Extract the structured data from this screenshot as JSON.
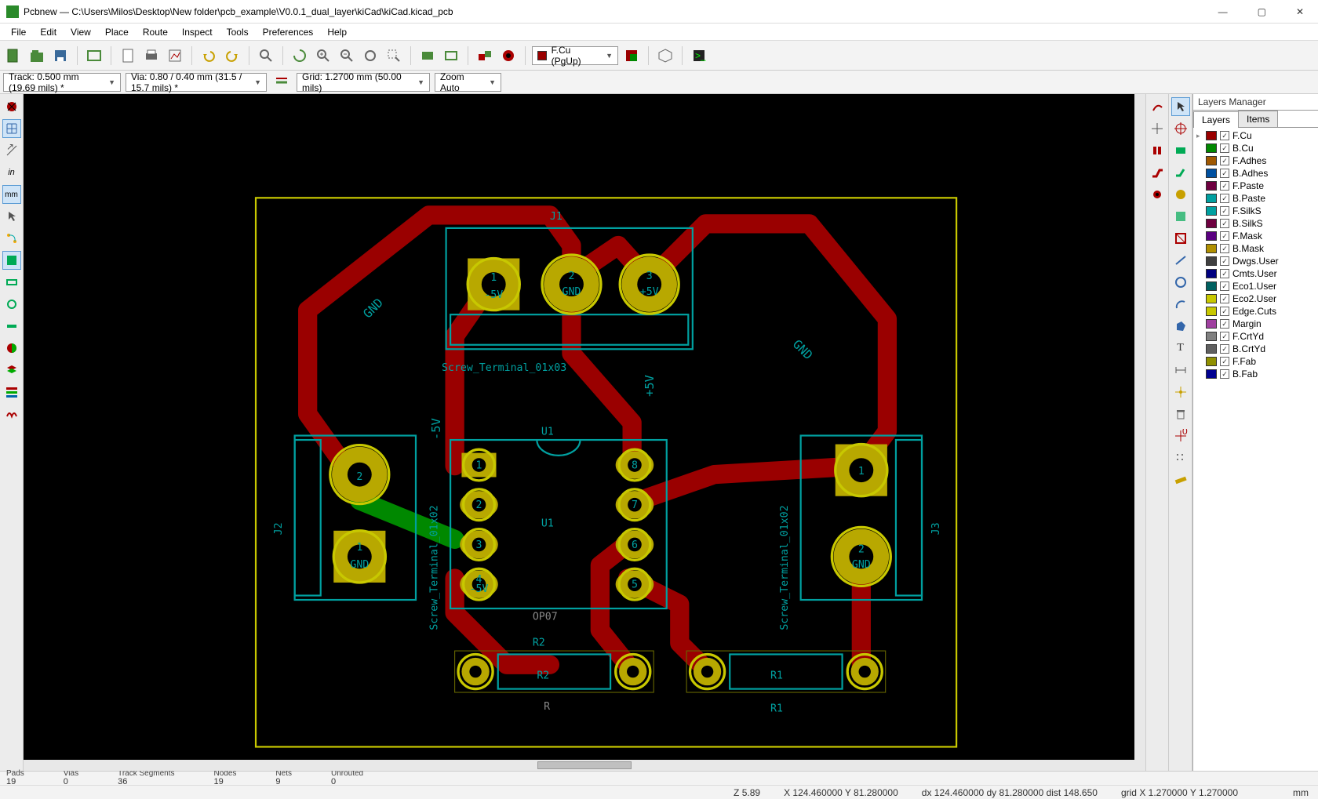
{
  "window": {
    "title": "Pcbnew — C:\\Users\\Milos\\Desktop\\New folder\\pcb_example\\V0.0.1_dual_layer\\kiCad\\kiCad.kicad_pcb"
  },
  "menubar": [
    "File",
    "Edit",
    "View",
    "Place",
    "Route",
    "Inspect",
    "Tools",
    "Preferences",
    "Help"
  ],
  "toolbar1": {
    "layer_combo": "F.Cu (PgUp)"
  },
  "toolbar2": {
    "track": "Track: 0.500 mm (19.69 mils) *",
    "via": "Via: 0.80 / 0.40 mm (31.5 / 15.7 mils) *",
    "grid": "Grid: 1.2700 mm (50.00 mils)",
    "zoom": "Zoom Auto"
  },
  "layers_panel": {
    "title": "Layers Manager",
    "tabs": [
      "Layers",
      "Items"
    ],
    "layers": [
      {
        "swatch": "#9a0000",
        "name": "F.Cu",
        "current": true
      },
      {
        "swatch": "#008800",
        "name": "B.Cu"
      },
      {
        "swatch": "#a05800",
        "name": "F.Adhes"
      },
      {
        "swatch": "#0050a0",
        "name": "B.Adhes"
      },
      {
        "swatch": "#6e0040",
        "name": "F.Paste"
      },
      {
        "swatch": "#00a0a0",
        "name": "B.Paste"
      },
      {
        "swatch": "#00a0a0",
        "name": "F.SilkS"
      },
      {
        "swatch": "#6e0040",
        "name": "B.SilkS"
      },
      {
        "swatch": "#5a0080",
        "name": "F.Mask"
      },
      {
        "swatch": "#b09000",
        "name": "B.Mask"
      },
      {
        "swatch": "#404040",
        "name": "Dwgs.User"
      },
      {
        "swatch": "#000080",
        "name": "Cmts.User"
      },
      {
        "swatch": "#006060",
        "name": "Eco1.User"
      },
      {
        "swatch": "#c8c800",
        "name": "Eco2.User"
      },
      {
        "swatch": "#c8c800",
        "name": "Edge.Cuts"
      },
      {
        "swatch": "#a040a0",
        "name": "Margin"
      },
      {
        "swatch": "#808080",
        "name": "F.CrtYd"
      },
      {
        "swatch": "#606060",
        "name": "B.CrtYd"
      },
      {
        "swatch": "#909000",
        "name": "F.Fab"
      },
      {
        "swatch": "#000090",
        "name": "B.Fab"
      }
    ]
  },
  "status1": {
    "cols": [
      {
        "label": "Pads",
        "val": "19"
      },
      {
        "label": "Vias",
        "val": "0"
      },
      {
        "label": "Track Segments",
        "val": "36"
      },
      {
        "label": "Nodes",
        "val": "19"
      },
      {
        "label": "Nets",
        "val": "9"
      },
      {
        "label": "Unrouted",
        "val": "0"
      }
    ]
  },
  "status2": {
    "z": "Z 5.89",
    "xy": "X 124.460000  Y 81.280000",
    "dxy": "dx 124.460000  dy 81.280000  dist 148.650",
    "grid": "grid X 1.270000  Y 1.270000",
    "unit": "mm"
  },
  "pcb": {
    "refs": {
      "J1": "J1",
      "J2": "J2",
      "J3": "J3",
      "U1": "U1",
      "R1": "R1",
      "R2": "R2",
      "screw3": "Screw_Terminal_01x03",
      "screw2a": "Screw_Terminal_01x02",
      "screw2b": "Screw_Terminal_01x02",
      "op07": "OP07",
      "R": "R"
    },
    "pads": {
      "j1_1": "1",
      "j1_1b": "-5V",
      "j1_2": "2",
      "j1_2b": "GND",
      "j1_3": "3",
      "j1_3b": "+5V",
      "j2_1": "1",
      "j2_1b": "GND",
      "j2_2": "2",
      "j3_1": "1",
      "j3_2": "2",
      "j3_2b": "GND",
      "u1": "1",
      "u2": "2",
      "u3": "3",
      "u4": "4",
      "u4b": "-5V",
      "u5": "5",
      "u6": "6",
      "u7": "7",
      "u8": "8"
    },
    "netlabels": {
      "gnd": "GND",
      "p5v": "+5V",
      "m5v": "-5V"
    }
  }
}
